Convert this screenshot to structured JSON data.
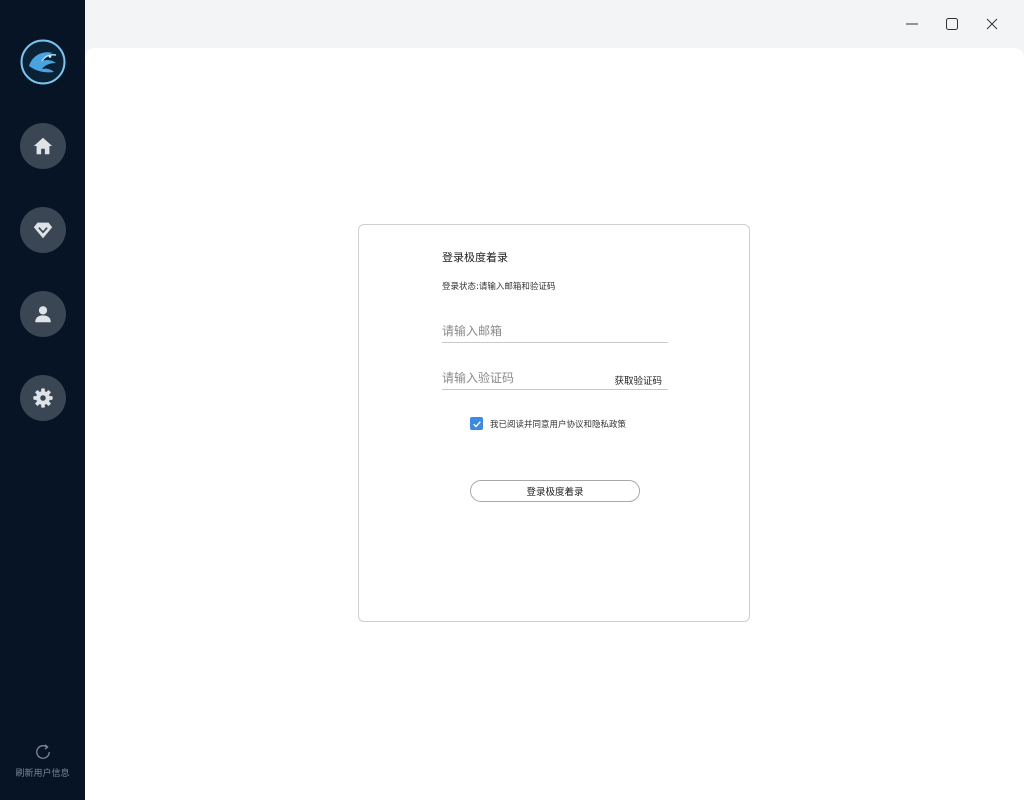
{
  "sidebar": {
    "logo_icon": "eagle-logo",
    "items": [
      {
        "name": "home",
        "icon": "home-icon"
      },
      {
        "name": "vip",
        "icon": "diamond-icon"
      },
      {
        "name": "user",
        "icon": "user-icon"
      },
      {
        "name": "settings",
        "icon": "gear-icon"
      }
    ],
    "refresh_label": "刷新用户信息",
    "background": "#061425",
    "button_color": "#3a4653"
  },
  "window_controls": [
    "minimize-icon",
    "maximize-icon",
    "close-icon"
  ],
  "login": {
    "title": "登录极度着录",
    "status": "登录状态:请输入邮箱和验证码",
    "email_placeholder": "请输入邮箱",
    "email_value": "",
    "code_placeholder": "请输入验证码",
    "code_value": "",
    "get_code_label": "获取验证码",
    "agree_checked": true,
    "agree_text": "我已阅读并同意用户协议和隐私政策",
    "submit_label": "登录极度着录",
    "checkbox_color": "#3d8be0"
  }
}
